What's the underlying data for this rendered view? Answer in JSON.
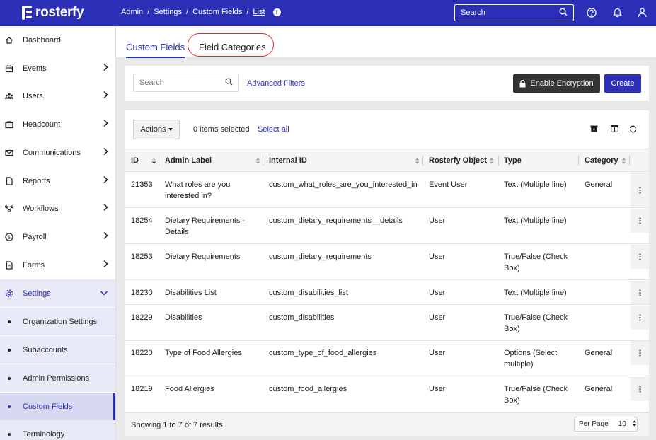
{
  "brand": {
    "name": "rosterfy"
  },
  "breadcrumb": [
    "Admin",
    "Settings",
    "Custom Fields",
    "List"
  ],
  "search": {
    "placeholder": "Search"
  },
  "sidebar": {
    "items": [
      {
        "label": "Dashboard",
        "icon": "home-icon",
        "chevron": false
      },
      {
        "label": "Events",
        "icon": "calendar-icon",
        "chevron": true
      },
      {
        "label": "Users",
        "icon": "users-icon",
        "chevron": true
      },
      {
        "label": "Headcount",
        "icon": "briefcase-icon",
        "chevron": true
      },
      {
        "label": "Communications",
        "icon": "envelope-icon",
        "chevron": true
      },
      {
        "label": "Reports",
        "icon": "file-icon",
        "chevron": true
      },
      {
        "label": "Workflows",
        "icon": "workflow-icon",
        "chevron": true
      },
      {
        "label": "Payroll",
        "icon": "dollar-icon",
        "chevron": true
      },
      {
        "label": "Forms",
        "icon": "form-icon",
        "chevron": true
      },
      {
        "label": "Settings",
        "icon": "gear-icon",
        "chevron": "down"
      }
    ],
    "subitems": [
      "Organization Settings",
      "Subaccounts",
      "Admin Permissions",
      "Custom Fields",
      "Terminology"
    ],
    "active_sub": "Custom Fields"
  },
  "tabs": {
    "custom_fields": "Custom Fields",
    "field_categories": "Field Categories"
  },
  "filters": {
    "search_placeholder": "Search",
    "advanced": "Advanced Filters",
    "encrypt": "Enable Encryption",
    "create": "Create"
  },
  "toolbar": {
    "actions": "Actions",
    "selected": "0 items selected",
    "select_all": "Select all"
  },
  "table": {
    "columns": [
      "ID",
      "Admin Label",
      "Internal ID",
      "Rosterfy Object",
      "Type",
      "Category"
    ],
    "rows": [
      {
        "id": "21353",
        "label": [
          "What roles are you",
          "interested in?"
        ],
        "internal": "custom_what_roles_are_you_interested_in",
        "object": "Event User",
        "type": [
          "Text (Multiple line)"
        ],
        "category": "General"
      },
      {
        "id": "18254",
        "label": [
          "Dietary Requirements -",
          "Details"
        ],
        "internal": "custom_dietary_requirements__details",
        "object": "User",
        "type": [
          "Text (Multiple line)"
        ],
        "category": ""
      },
      {
        "id": "18253",
        "label": [
          "Dietary Requirements"
        ],
        "internal": "custom_dietary_requirements",
        "object": "User",
        "type": [
          "True/False (Check",
          "Box)"
        ],
        "category": ""
      },
      {
        "id": "18230",
        "label": [
          "Disabilities List"
        ],
        "internal": "custom_disabilities_list",
        "object": "User",
        "type": [
          "Text (Multiple line)"
        ],
        "category": ""
      },
      {
        "id": "18229",
        "label": [
          "Disabilities"
        ],
        "internal": "custom_disabilities",
        "object": "User",
        "type": [
          "True/False (Check",
          "Box)"
        ],
        "category": ""
      },
      {
        "id": "18220",
        "label": [
          "Type of Food Allergies"
        ],
        "internal": "custom_type_of_food_allergies",
        "object": "User",
        "type": [
          "Options (Select",
          "multiple)"
        ],
        "category": "General"
      },
      {
        "id": "18219",
        "label": [
          "Food Allergies"
        ],
        "internal": "custom_food_allergies",
        "object": "User",
        "type": [
          "True/False (Check",
          "Box)"
        ],
        "category": "General"
      }
    ]
  },
  "footer": {
    "showing": "Showing 1 to 7 of 7 results",
    "per_page_label": "Per Page",
    "per_page_value": "10"
  },
  "colors": {
    "primary": "#2b2fb5",
    "dark_button": "#333333",
    "highlight": "#e02b2b"
  }
}
